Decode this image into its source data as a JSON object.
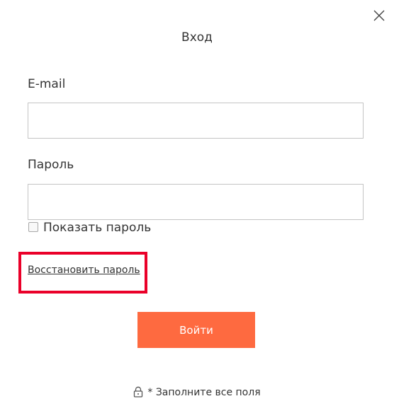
{
  "dialog": {
    "title": "Вход",
    "close_icon": "close-icon"
  },
  "form": {
    "email_label": "E-mail",
    "email_value": "",
    "email_placeholder": "",
    "password_label": "Пароль",
    "password_value": "",
    "password_placeholder": "",
    "show_password_label": "Показать пароль",
    "show_password_checked": false,
    "restore_password_link": "Восстановить пароль",
    "submit_label": "Войти"
  },
  "footer": {
    "lock_icon": "lock-icon",
    "note": "* Заполните все поля"
  },
  "colors": {
    "submit_button": "#fe6a40",
    "highlight_border": "#ea0029",
    "text": "#333333"
  }
}
